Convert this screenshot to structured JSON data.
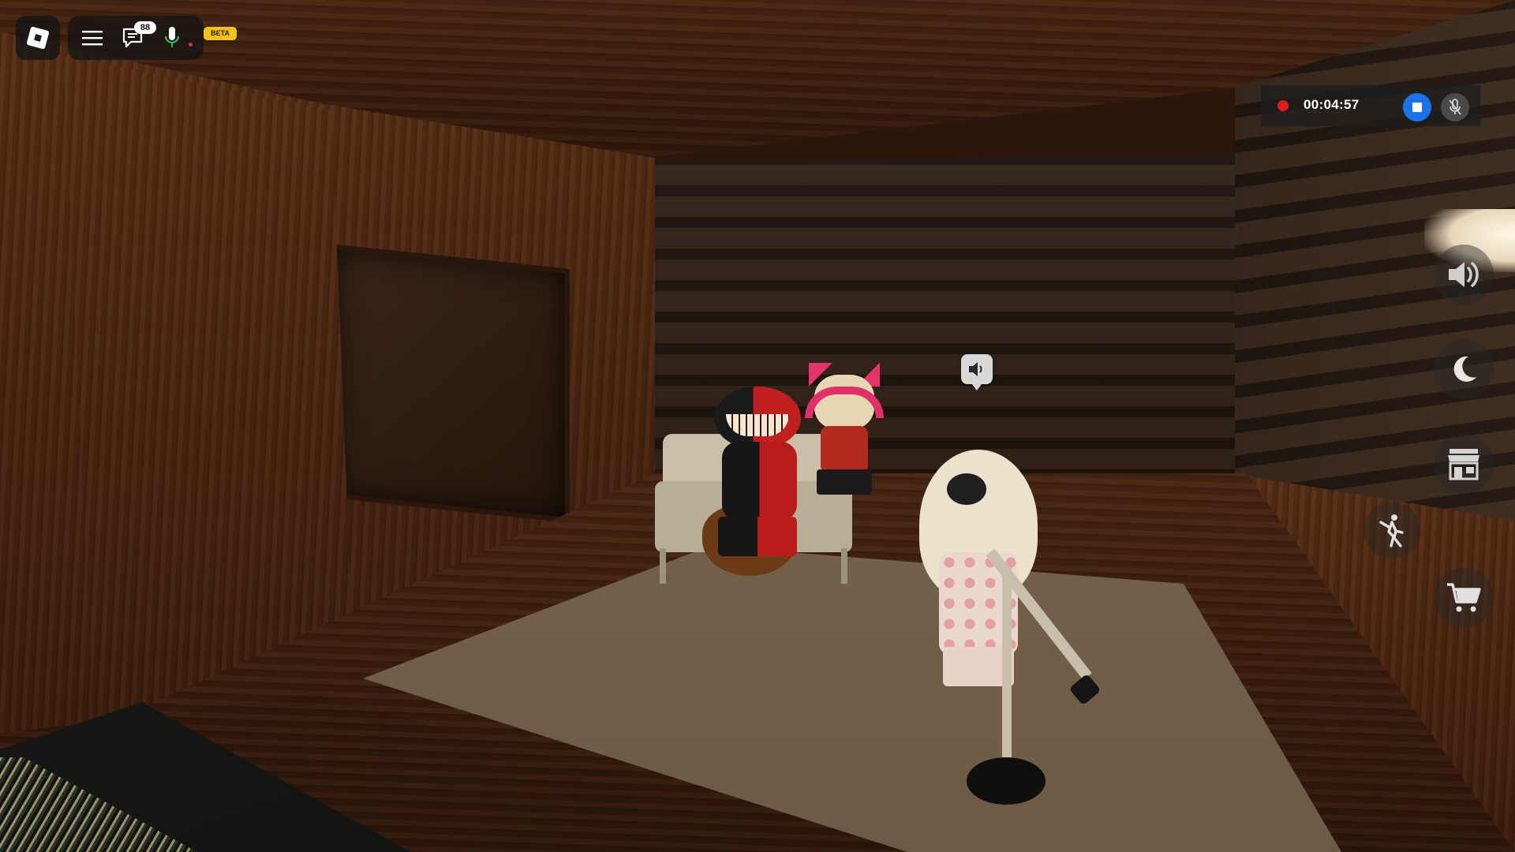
{
  "hud": {
    "roblox_menu_icon": "roblox-logo-icon",
    "hamburger_icon": "hamburger-menu-icon",
    "chat_icon": "chat-bubble-icon",
    "chat_unread_count": "88",
    "mic_icon": "microphone-icon",
    "mic_status_color": "#e03030",
    "beta_label": "BETA",
    "beta_color": "#f2c21b"
  },
  "recording": {
    "indicator_color": "#e21b1b",
    "elapsed": "00:04:57",
    "stop_icon": "stop-icon",
    "stop_color": "#1a73e8",
    "mute_icon": "microphone-muted-icon"
  },
  "side_buttons": [
    {
      "name": "sound",
      "icon": "speaker-volume-icon"
    },
    {
      "name": "night-mode",
      "icon": "crescent-moon-icon"
    },
    {
      "name": "shop",
      "icon": "storefront-icon"
    },
    {
      "name": "emote",
      "icon": "dance-figure-icon"
    },
    {
      "name": "cart",
      "icon": "shopping-cart-icon"
    }
  ],
  "world": {
    "speaker_bubble_icon": "speaker-icon"
  }
}
